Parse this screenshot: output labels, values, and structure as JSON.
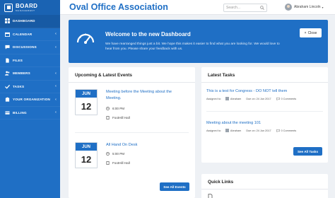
{
  "brand": {
    "title": "BOARD",
    "subtitle": "MANAGEMENT"
  },
  "sidebar": {
    "items": [
      {
        "label": "DASHBOARD",
        "icon": "dashboard-icon",
        "has_submenu": false,
        "active": true
      },
      {
        "label": "CALENDAR",
        "icon": "calendar-icon",
        "has_submenu": true,
        "active": false
      },
      {
        "label": "DISCUSSIONS",
        "icon": "chat-icon",
        "has_submenu": true,
        "active": false
      },
      {
        "label": "FILES",
        "icon": "file-icon",
        "has_submenu": false,
        "active": false
      },
      {
        "label": "MEMBERS",
        "icon": "users-icon",
        "has_submenu": true,
        "active": false
      },
      {
        "label": "TASKS",
        "icon": "tasks-icon",
        "has_submenu": true,
        "active": false
      },
      {
        "label": "YOUR ORGANIZATION",
        "icon": "organization-icon",
        "has_submenu": true,
        "active": false
      },
      {
        "label": "BILLING",
        "icon": "billing-icon",
        "has_submenu": true,
        "active": false
      }
    ],
    "chevron": "‹"
  },
  "header": {
    "title": "Oval Office Association",
    "search_placeholder": "Search...",
    "user_name": "Abraham Lincoln",
    "user_caret": "▾"
  },
  "welcome": {
    "title": "Welcome to the new Dashboard",
    "text": "We have rearranged things just a bit. We hope this makes it easier to find what you are looking for. We would love to hear from you. Please share your feedback with us.",
    "close_icon": "×",
    "close_label": "Close"
  },
  "events": {
    "title": "Upcoming & Latest Events",
    "items": [
      {
        "month": "JUN",
        "day": "12",
        "title": "Meeting before the Meeting about the Meeting.",
        "time": "6:00 PM",
        "location": "FootHill Hall"
      },
      {
        "month": "JUN",
        "day": "12",
        "title": "All Hand On Desk",
        "time": "5:00 PM",
        "location": "FootHill Hall"
      }
    ],
    "see_all_label": "See All Events"
  },
  "tasks": {
    "title": "Latest Tasks",
    "assigned_to_label": "Assigned to:",
    "items": [
      {
        "title": "This is a test for Congress - DO NOT tell them",
        "assignee": "Abraham",
        "due": "Due on: 24 Jun 2017",
        "comments": "0 Comments"
      },
      {
        "title": "Meeting about the meeting 101",
        "assignee": "Abraham",
        "due": "Due on: 24 Jun 2017",
        "comments": "0 Comments"
      }
    ],
    "see_all_label": "See All Tasks"
  },
  "quick_links": {
    "title": "Quick Links"
  },
  "colors": {
    "primary": "#1f6fc5",
    "sidebar_active": "#175aa4",
    "background": "#eef1f5"
  }
}
